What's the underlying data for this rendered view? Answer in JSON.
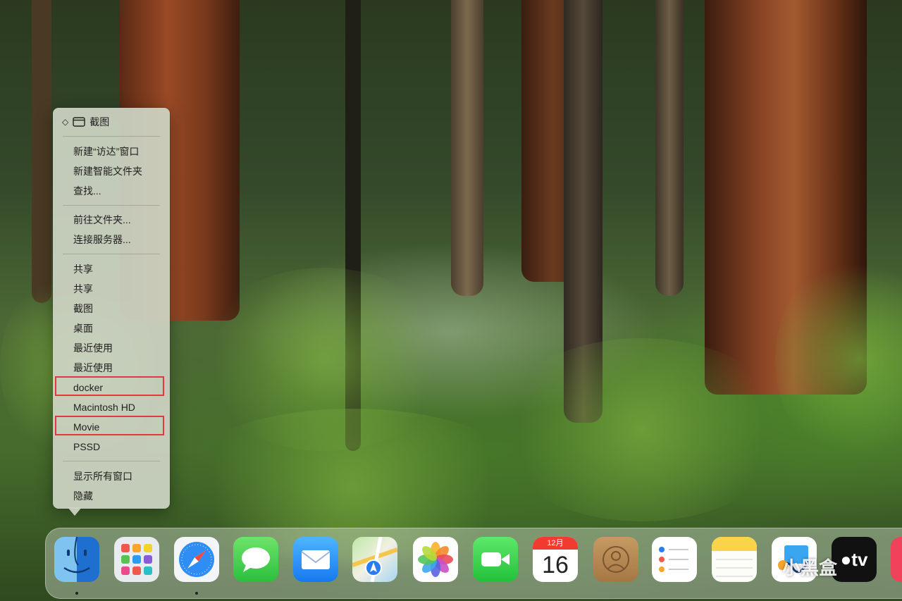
{
  "context_menu": {
    "header_label": "截图",
    "groups": [
      [
        "新建“访达”窗口",
        "新建智能文件夹",
        "查找..."
      ],
      [
        "前往文件夹...",
        "连接服务器..."
      ],
      [
        "共享",
        "共享",
        "截图",
        "桌面",
        "最近使用",
        "最近使用",
        "docker",
        "Macintosh HD",
        "Movie",
        "PSSD"
      ],
      [
        "显示所有窗口",
        "隐藏"
      ]
    ],
    "highlighted_items": [
      "docker",
      "Movie"
    ]
  },
  "dock": {
    "apps": [
      "Finder",
      "Launchpad",
      "Safari",
      "Messages",
      "Mail",
      "Maps",
      "Photos",
      "FaceTime",
      "Calendar",
      "Contacts",
      "Reminders",
      "Notes",
      "Freeform",
      "TV"
    ],
    "calendar": {
      "month": "12月",
      "day": "16"
    },
    "tv_label": "tv"
  },
  "watermark": "小黑盒",
  "colors": {
    "highlight_border": "#e0393b",
    "menu_bg": "#ced4c4"
  }
}
